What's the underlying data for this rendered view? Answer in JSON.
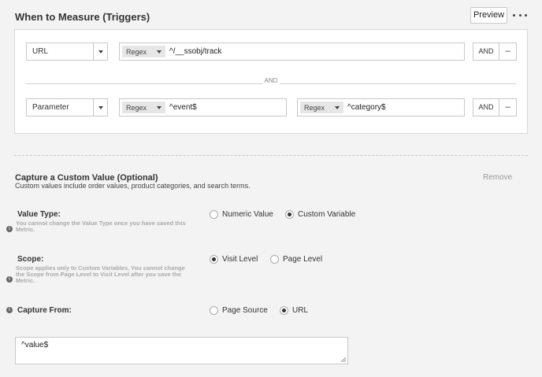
{
  "header": {
    "title": "When to Measure (Triggers)",
    "preview_label": "Preview",
    "more_icon": "more-horizontal-icon"
  },
  "triggers": {
    "row1": {
      "type": "URL",
      "match1": {
        "mode": "Regex",
        "value": "^/__ssobj/track"
      },
      "and_label": "AND",
      "remove_label": "–"
    },
    "separator": "AND",
    "row2": {
      "type": "Parameter",
      "match1": {
        "mode": "Regex",
        "value": "^event$"
      },
      "match2": {
        "mode": "Regex",
        "value": "^category$"
      },
      "and_label": "AND",
      "remove_label": "–"
    }
  },
  "capture": {
    "title": "Capture a Custom Value (Optional)",
    "subtitle": "Custom values include order values, product categories, and search terms.",
    "remove_label": "Remove",
    "value_type": {
      "label": "Value Type:",
      "help_line1": "You cannot change the Value Type once you have saved this",
      "help_line2": "Metric.",
      "options": [
        "Numeric Value",
        "Custom Variable"
      ],
      "selected": "Custom Variable"
    },
    "scope": {
      "label": "Scope:",
      "help_line1": "Scope applies only to Custom Variables. You cannot change",
      "help_line2": "the Scope from Page Level to Visit Level after you save the",
      "help_line3": "Metric.",
      "options": [
        "Visit Level",
        "Page Level"
      ],
      "selected": "Visit Level"
    },
    "capture_from": {
      "label": "Capture From:",
      "options": [
        "Page Source",
        "URL"
      ],
      "selected": "URL"
    },
    "expression": "^value$"
  },
  "colors": {
    "background": "#f3f3f3",
    "panel": "#ffffff",
    "border": "#c8c8c8",
    "muted_text": "#aaaaaa"
  }
}
